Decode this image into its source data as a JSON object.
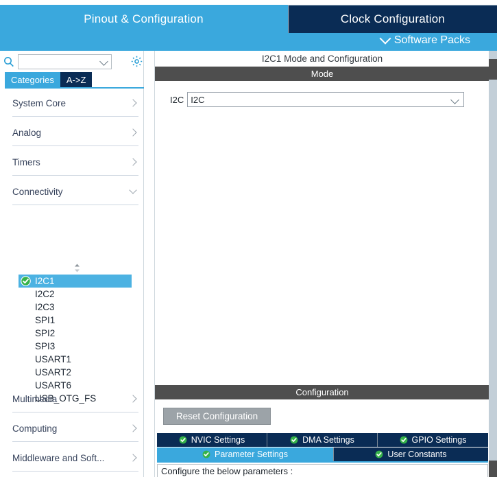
{
  "top_tabs": [
    {
      "label": "Pinout & Configuration",
      "active": true
    },
    {
      "label": "Clock Configuration",
      "active": false
    }
  ],
  "software_packs": {
    "label": "Software Packs",
    "icon": "chevron-down-icon"
  },
  "sidebar": {
    "search": {
      "value": "",
      "placeholder": "",
      "icon": "search-icon"
    },
    "settings_icon": "gear-icon",
    "view_toggle": [
      {
        "label": "Categories",
        "active": true
      },
      {
        "label": "A->Z",
        "active": false
      }
    ],
    "categories": [
      {
        "label": "System Core",
        "expanded": false
      },
      {
        "label": "Analog",
        "expanded": false
      },
      {
        "label": "Timers",
        "expanded": false
      },
      {
        "label": "Connectivity",
        "expanded": true
      }
    ],
    "sort_icon": "sort-updown-icon",
    "peripherals": [
      {
        "label": "I2C1",
        "selected": true,
        "configured": true
      },
      {
        "label": "I2C2",
        "selected": false,
        "configured": false
      },
      {
        "label": "I2C3",
        "selected": false,
        "configured": false
      },
      {
        "label": "SPI1",
        "selected": false,
        "configured": false
      },
      {
        "label": "SPI2",
        "selected": false,
        "configured": false
      },
      {
        "label": "SPI3",
        "selected": false,
        "configured": false
      },
      {
        "label": "USART1",
        "selected": false,
        "configured": false
      },
      {
        "label": "USART2",
        "selected": false,
        "configured": false
      },
      {
        "label": "USART6",
        "selected": false,
        "configured": false
      },
      {
        "label": "USB_OTG_FS",
        "selected": false,
        "configured": false
      }
    ],
    "categories_bottom": [
      {
        "label": "Multimedia",
        "expanded": false
      },
      {
        "label": "Computing",
        "expanded": false
      },
      {
        "label": "Middleware and Soft...",
        "expanded": false
      }
    ]
  },
  "main": {
    "title": "I2C1 Mode and Configuration",
    "mode_section": {
      "header": "Mode",
      "field_label": "I2C",
      "field_value": "I2C",
      "caret_icon": "chevron-down-icon"
    },
    "config_section": {
      "header": "Configuration",
      "reset_button": "Reset Configuration",
      "tabs_row1": [
        {
          "label": "NVIC Settings",
          "active": false,
          "icon": "green-check-icon"
        },
        {
          "label": "DMA Settings",
          "active": false,
          "icon": "green-check-icon"
        },
        {
          "label": "GPIO Settings",
          "active": false,
          "icon": "green-check-icon"
        }
      ],
      "tabs_row2": [
        {
          "label": "Parameter Settings",
          "active": true,
          "icon": "green-check-icon"
        },
        {
          "label": "User Constants",
          "active": false,
          "icon": "green-check-icon"
        }
      ],
      "parameters_note": "Configure the below parameters :"
    }
  },
  "colors": {
    "accent_blue": "#3aa8dd",
    "dark_navy": "#0a2c55",
    "section_gray": "#4e4e4e",
    "selected_row": "#4cb2e2",
    "check_green": "#36b34a",
    "button_gray": "#9ca3a8"
  }
}
